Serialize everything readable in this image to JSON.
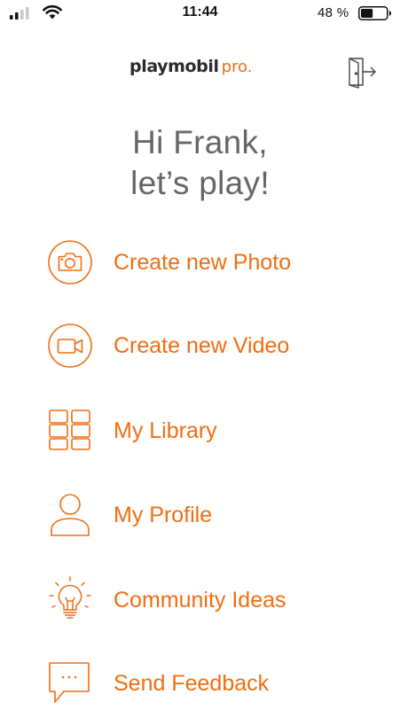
{
  "status_bar": {
    "time": "11:44",
    "battery_percent": "48 %",
    "battery_level": 0.48,
    "signal_bars": 2
  },
  "header": {
    "brand_main": "playmobil",
    "brand_sub": "pro."
  },
  "greeting": {
    "line1": "Hi Frank,",
    "line2": "let’s play!"
  },
  "menu": {
    "items": [
      {
        "label": "Create new Photo",
        "icon": "camera-icon"
      },
      {
        "label": "Create new Video",
        "icon": "video-camera-icon"
      },
      {
        "label": "My Library",
        "icon": "grid-icon"
      },
      {
        "label": "My Profile",
        "icon": "user-icon"
      },
      {
        "label": "Community Ideas",
        "icon": "lightbulb-icon"
      },
      {
        "label": "Send Feedback",
        "icon": "chat-bubble-icon"
      }
    ]
  },
  "colors": {
    "accent": "#f06e12",
    "greeting_text": "#666666",
    "status_text": "#111111"
  }
}
